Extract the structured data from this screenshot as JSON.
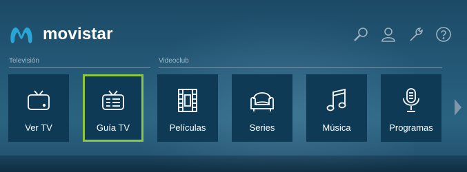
{
  "brand": {
    "name": "movistar",
    "logo_color": "#2aa5d8"
  },
  "top_icons": [
    "search-icon",
    "user-icon",
    "settings-wrench-icon",
    "help-icon"
  ],
  "sections": [
    {
      "label": "Televisión"
    },
    {
      "label": "Videoclub"
    }
  ],
  "tiles": [
    {
      "label": "Ver TV",
      "icon": "tv-icon",
      "selected": false
    },
    {
      "label": "Guía TV",
      "icon": "tv-guide-icon",
      "selected": true
    },
    {
      "label": "Películas",
      "icon": "film-icon",
      "selected": false
    },
    {
      "label": "Series",
      "icon": "armchair-icon",
      "selected": false
    },
    {
      "label": "Música",
      "icon": "music-note-icon",
      "selected": false
    },
    {
      "label": "Programas",
      "icon": "microphone-icon",
      "selected": false
    }
  ],
  "colors": {
    "selected_border": "#8dc63f",
    "tile_bg": "#0f3a56"
  }
}
